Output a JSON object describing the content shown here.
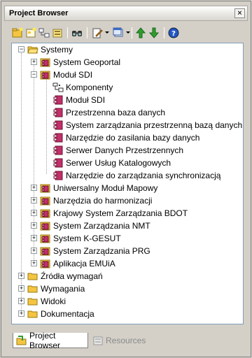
{
  "window": {
    "title": "Project Browser",
    "close_glyph": "×"
  },
  "toolbar": {
    "buttons": [
      "new-package-icon",
      "new-diagram-icon",
      "new-element-icon",
      "new-model-icon",
      "find-icon",
      "edit-icon",
      "view-icon",
      "move-up-icon",
      "move-down-icon",
      "help-icon"
    ]
  },
  "tree": {
    "systemy": "Systemy",
    "system_geoportal": "System Geoportal",
    "modul_sdi": "Moduł SDI",
    "komponenty": "Komponenty",
    "modul_sdi_child": "Moduł SDI",
    "przestrzenna": "Przestrzenna baza danych",
    "system_zarzadzania_baza": "System zarządzania przestrzenną bazą danych",
    "narzedzie_zasilania": "Narzędzie do zasilania bazy danych",
    "serwer_danych": "Serwer Danych Przestrzennych",
    "serwer_uslug": "Serwer Usług Katalogowych",
    "narzedzie_synchronizacji": "Narzędzie do zarządzania synchronizacją",
    "uniwersalny": "Uniwersalny Moduł Mapowy",
    "narzedzia_harmonizacji": "Narzędzia do harmonizacji",
    "krajowy": "Krajowy System Zarządzania BDOT",
    "nmt": "System Zarządzania NMT",
    "kgesut": "System K-GESUT",
    "prg": "System Zarządzania PRG",
    "emuia": "Aplikacja EMUiA",
    "zrodla": "Źródła wymagań",
    "wymagania": "Wymagania",
    "widoki": "Widoki",
    "dokumentacja": "Dokumentacja"
  },
  "tabs": {
    "project_browser": "Project Browser",
    "resources": "Resources"
  },
  "colors": {
    "folder": "#f4c542",
    "component": "#c0306a",
    "accent_green": "#2e9e2e",
    "help_blue": "#2356c5"
  }
}
